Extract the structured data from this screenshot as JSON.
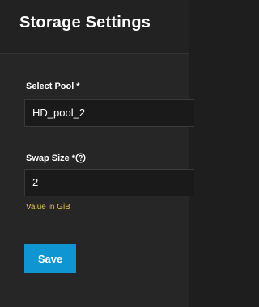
{
  "header": {
    "title": "Storage Settings"
  },
  "form": {
    "pool": {
      "label": "Select Pool",
      "required_marker": "*",
      "value": "HD_pool_2"
    },
    "swap": {
      "label": "Swap Size",
      "required_marker": "*",
      "value": "2",
      "hint": "Value in GiB",
      "help_icon": "help-circle-icon"
    },
    "save_label": "Save"
  },
  "colors": {
    "background": "#262626",
    "header_background": "#222222",
    "input_background": "#1a1a1a",
    "accent": "#0f95d1",
    "hint_text": "#e6c44a"
  }
}
